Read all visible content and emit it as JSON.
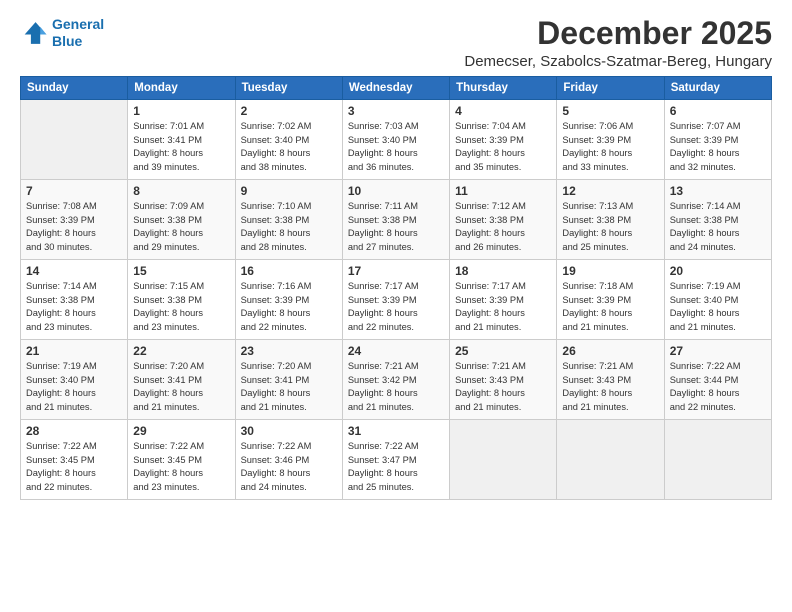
{
  "logo": {
    "line1": "General",
    "line2": "Blue"
  },
  "title": "December 2025",
  "subtitle": "Demecser, Szabolcs-Szatmar-Bereg, Hungary",
  "days_header": [
    "Sunday",
    "Monday",
    "Tuesday",
    "Wednesday",
    "Thursday",
    "Friday",
    "Saturday"
  ],
  "weeks": [
    [
      {
        "day": "",
        "content": ""
      },
      {
        "day": "1",
        "content": "Sunrise: 7:01 AM\nSunset: 3:41 PM\nDaylight: 8 hours\nand 39 minutes."
      },
      {
        "day": "2",
        "content": "Sunrise: 7:02 AM\nSunset: 3:40 PM\nDaylight: 8 hours\nand 38 minutes."
      },
      {
        "day": "3",
        "content": "Sunrise: 7:03 AM\nSunset: 3:40 PM\nDaylight: 8 hours\nand 36 minutes."
      },
      {
        "day": "4",
        "content": "Sunrise: 7:04 AM\nSunset: 3:39 PM\nDaylight: 8 hours\nand 35 minutes."
      },
      {
        "day": "5",
        "content": "Sunrise: 7:06 AM\nSunset: 3:39 PM\nDaylight: 8 hours\nand 33 minutes."
      },
      {
        "day": "6",
        "content": "Sunrise: 7:07 AM\nSunset: 3:39 PM\nDaylight: 8 hours\nand 32 minutes."
      }
    ],
    [
      {
        "day": "7",
        "content": "Sunrise: 7:08 AM\nSunset: 3:39 PM\nDaylight: 8 hours\nand 30 minutes."
      },
      {
        "day": "8",
        "content": "Sunrise: 7:09 AM\nSunset: 3:38 PM\nDaylight: 8 hours\nand 29 minutes."
      },
      {
        "day": "9",
        "content": "Sunrise: 7:10 AM\nSunset: 3:38 PM\nDaylight: 8 hours\nand 28 minutes."
      },
      {
        "day": "10",
        "content": "Sunrise: 7:11 AM\nSunset: 3:38 PM\nDaylight: 8 hours\nand 27 minutes."
      },
      {
        "day": "11",
        "content": "Sunrise: 7:12 AM\nSunset: 3:38 PM\nDaylight: 8 hours\nand 26 minutes."
      },
      {
        "day": "12",
        "content": "Sunrise: 7:13 AM\nSunset: 3:38 PM\nDaylight: 8 hours\nand 25 minutes."
      },
      {
        "day": "13",
        "content": "Sunrise: 7:14 AM\nSunset: 3:38 PM\nDaylight: 8 hours\nand 24 minutes."
      }
    ],
    [
      {
        "day": "14",
        "content": "Sunrise: 7:14 AM\nSunset: 3:38 PM\nDaylight: 8 hours\nand 23 minutes."
      },
      {
        "day": "15",
        "content": "Sunrise: 7:15 AM\nSunset: 3:38 PM\nDaylight: 8 hours\nand 23 minutes."
      },
      {
        "day": "16",
        "content": "Sunrise: 7:16 AM\nSunset: 3:39 PM\nDaylight: 8 hours\nand 22 minutes."
      },
      {
        "day": "17",
        "content": "Sunrise: 7:17 AM\nSunset: 3:39 PM\nDaylight: 8 hours\nand 22 minutes."
      },
      {
        "day": "18",
        "content": "Sunrise: 7:17 AM\nSunset: 3:39 PM\nDaylight: 8 hours\nand 21 minutes."
      },
      {
        "day": "19",
        "content": "Sunrise: 7:18 AM\nSunset: 3:39 PM\nDaylight: 8 hours\nand 21 minutes."
      },
      {
        "day": "20",
        "content": "Sunrise: 7:19 AM\nSunset: 3:40 PM\nDaylight: 8 hours\nand 21 minutes."
      }
    ],
    [
      {
        "day": "21",
        "content": "Sunrise: 7:19 AM\nSunset: 3:40 PM\nDaylight: 8 hours\nand 21 minutes."
      },
      {
        "day": "22",
        "content": "Sunrise: 7:20 AM\nSunset: 3:41 PM\nDaylight: 8 hours\nand 21 minutes."
      },
      {
        "day": "23",
        "content": "Sunrise: 7:20 AM\nSunset: 3:41 PM\nDaylight: 8 hours\nand 21 minutes."
      },
      {
        "day": "24",
        "content": "Sunrise: 7:21 AM\nSunset: 3:42 PM\nDaylight: 8 hours\nand 21 minutes."
      },
      {
        "day": "25",
        "content": "Sunrise: 7:21 AM\nSunset: 3:43 PM\nDaylight: 8 hours\nand 21 minutes."
      },
      {
        "day": "26",
        "content": "Sunrise: 7:21 AM\nSunset: 3:43 PM\nDaylight: 8 hours\nand 21 minutes."
      },
      {
        "day": "27",
        "content": "Sunrise: 7:22 AM\nSunset: 3:44 PM\nDaylight: 8 hours\nand 22 minutes."
      }
    ],
    [
      {
        "day": "28",
        "content": "Sunrise: 7:22 AM\nSunset: 3:45 PM\nDaylight: 8 hours\nand 22 minutes."
      },
      {
        "day": "29",
        "content": "Sunrise: 7:22 AM\nSunset: 3:45 PM\nDaylight: 8 hours\nand 23 minutes."
      },
      {
        "day": "30",
        "content": "Sunrise: 7:22 AM\nSunset: 3:46 PM\nDaylight: 8 hours\nand 24 minutes."
      },
      {
        "day": "31",
        "content": "Sunrise: 7:22 AM\nSunset: 3:47 PM\nDaylight: 8 hours\nand 25 minutes."
      },
      {
        "day": "",
        "content": ""
      },
      {
        "day": "",
        "content": ""
      },
      {
        "day": "",
        "content": ""
      }
    ]
  ]
}
